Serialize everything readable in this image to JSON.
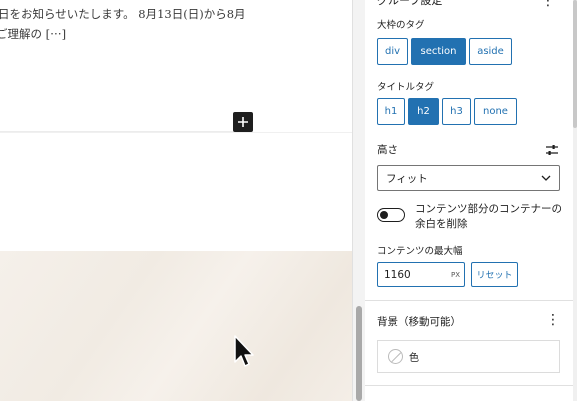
{
  "canvas": {
    "excerpt_line1": "日をお知らせいたします。 8月13日(日)から8月",
    "excerpt_line2": "ご理解の [⋯]",
    "inserter_icon": "plus-icon"
  },
  "sidebar": {
    "panel_title": "グループ設定",
    "outer_tag": {
      "label": "大枠のタグ",
      "options": [
        "div",
        "section",
        "aside"
      ],
      "selected": "section"
    },
    "title_tag": {
      "label": "タイトルタグ",
      "options": [
        "h1",
        "h2",
        "h3",
        "none"
      ],
      "selected": "h2"
    },
    "height": {
      "label": "高さ",
      "value": "フィット"
    },
    "remove_padding_toggle": {
      "label": "コンテンツ部分のコンテナーの余白を削除",
      "checked": true
    },
    "max_width": {
      "label": "コンテンツの最大幅",
      "value": "1160",
      "unit": "PX",
      "reset_label": "リセット"
    },
    "background": {
      "title": "背景（移動可能）",
      "color_label": "色"
    }
  },
  "colors": {
    "accent": "#2271b1",
    "text": "#1e1e1e",
    "canvas_texture": "#f3ede6"
  }
}
